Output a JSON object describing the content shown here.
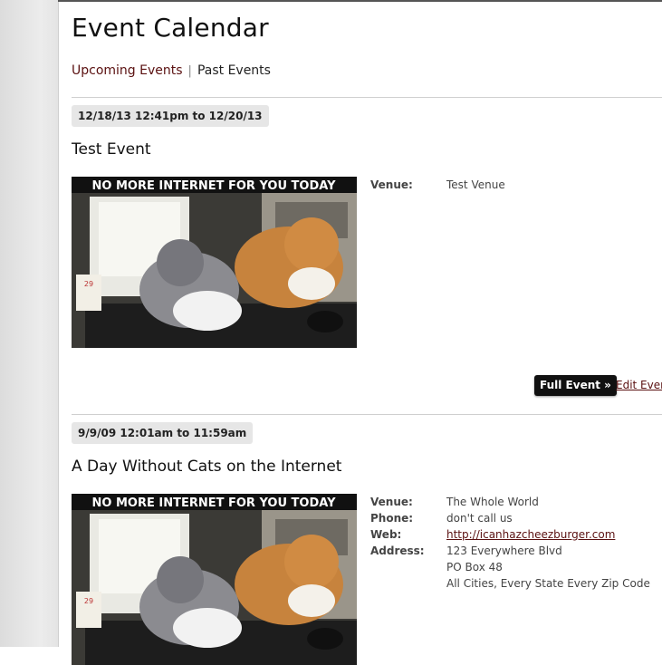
{
  "page": {
    "title": "Event Calendar",
    "tabs": [
      {
        "label": "Upcoming Events"
      },
      {
        "label": "Past Events"
      }
    ],
    "tab_separator": "|"
  },
  "events": [
    {
      "date_range": "12/18/13 12:41pm to 12/20/13",
      "title": "Test Event",
      "image_caption": "NO MORE INTERNET FOR YOU TODAY",
      "details": [
        {
          "label": "Venue:",
          "value": "Test Venue"
        }
      ],
      "actions": {
        "full_event": "Full Event »",
        "edit_event": "Edit Event"
      }
    },
    {
      "date_range": "9/9/09 12:01am to 11:59am",
      "title": "A Day Without Cats on the Internet",
      "image_caption": "NO MORE INTERNET FOR YOU TODAY",
      "details": [
        {
          "label": "Venue:",
          "value": "The Whole World"
        },
        {
          "label": "Phone:",
          "value": "don't call us"
        },
        {
          "label": "Web:",
          "value": "http://icanhazcheezburger.com"
        },
        {
          "label": "Address:",
          "value": "123 Everywhere Blvd"
        },
        {
          "label": "",
          "value": "PO Box 48"
        },
        {
          "label": "",
          "value": "All Cities, Every State Every Zip Code"
        }
      ]
    }
  ],
  "colors": {
    "link": "#5a1010",
    "badge_bg": "#e6e6e6",
    "button_bg": "#111111"
  }
}
